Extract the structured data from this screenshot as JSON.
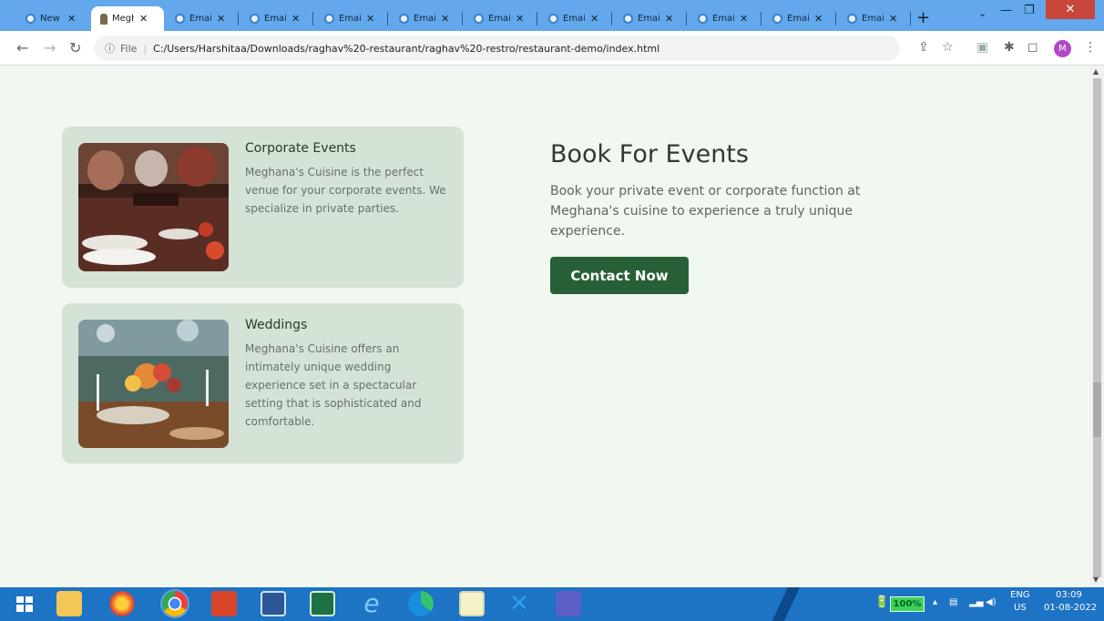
{
  "browser": {
    "tabs": [
      {
        "title": "New",
        "active": false
      },
      {
        "title": "Megh",
        "active": true
      },
      {
        "title": "Email",
        "active": false
      },
      {
        "title": "Email",
        "active": false
      },
      {
        "title": "Email",
        "active": false
      },
      {
        "title": "Email",
        "active": false
      },
      {
        "title": "Email",
        "active": false
      },
      {
        "title": "Email",
        "active": false
      },
      {
        "title": "Email",
        "active": false
      },
      {
        "title": "Email",
        "active": false
      },
      {
        "title": "Email",
        "active": false
      },
      {
        "title": "Email",
        "active": false
      },
      {
        "title": "Email",
        "active": false
      }
    ],
    "address": {
      "scheme_label": "File",
      "url": "C:/Users/Harshitaa/Downloads/raghav%20-restaurant/raghav%20-restro/restaurant-demo/index.html"
    },
    "profile_initial": "M"
  },
  "page": {
    "cards": [
      {
        "title": "Corporate Events",
        "text": "Meghana's Cuisine is the perfect venue for your corporate events. We specialize in private parties."
      },
      {
        "title": "Weddings",
        "text": "Meghana's Cuisine offers an intimately unique wedding experience set in a spectacular setting that is sophisticated and comfortable."
      }
    ],
    "book": {
      "title": "Book For Events",
      "description": "Book your private event or corporate function at Meghana's cuisine to experience a truly unique experience.",
      "button_label": "Contact Now"
    }
  },
  "taskbar": {
    "battery": "100%",
    "lang": "ENG",
    "region": "US",
    "time": "03:09",
    "date": "01-08-2022"
  }
}
